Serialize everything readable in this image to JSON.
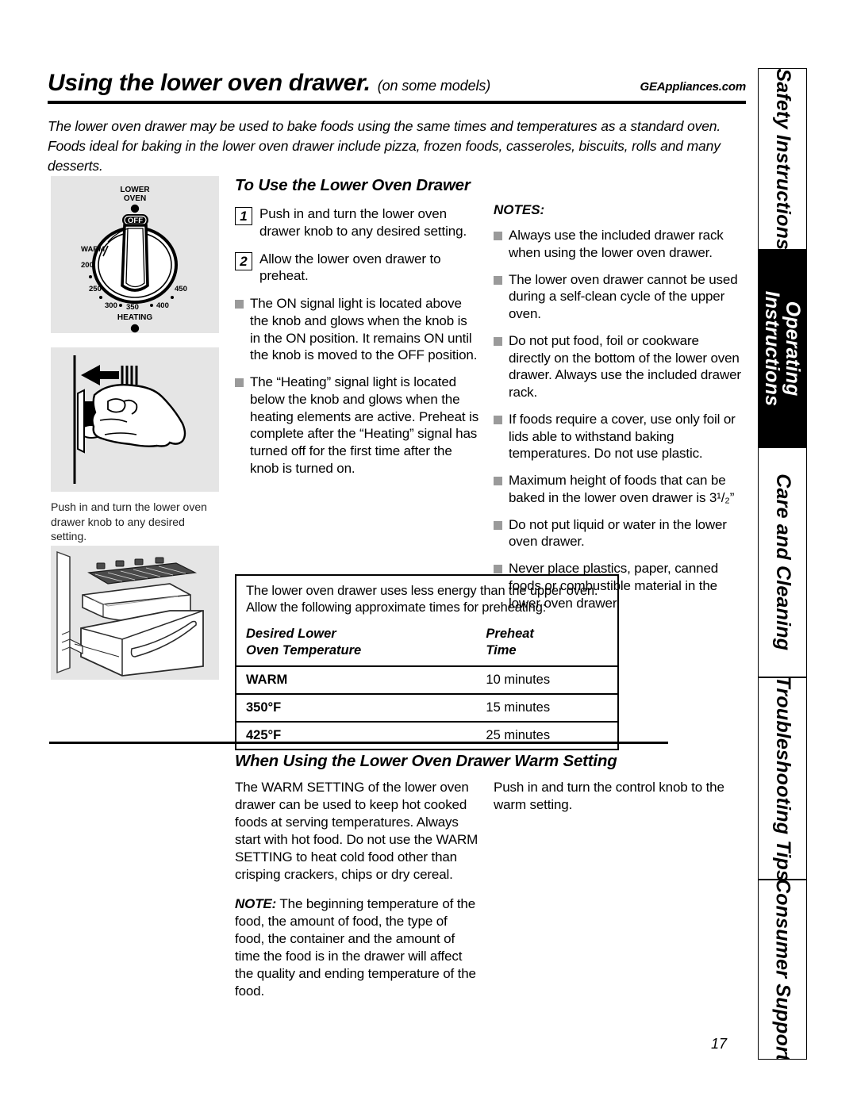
{
  "header": {
    "title": "Using the lower oven drawer.",
    "subtitle": "(on some models)",
    "url": "GEAppliances.com"
  },
  "intro": "The lower oven drawer may be used to bake foods using the same times and temperatures as a standard oven. Foods ideal for baking in the lower oven drawer include pizza, frozen foods, casseroles, biscuits, rolls and many desserts.",
  "sidebar": {
    "tabs": [
      {
        "label": "Safety Instructions",
        "active": false
      },
      {
        "label": "Operating Instructions",
        "active": true
      },
      {
        "label": "Care and Cleaning",
        "active": false
      },
      {
        "label": "Troubleshooting Tips",
        "active": false
      },
      {
        "label": "Consumer Support",
        "active": false
      }
    ]
  },
  "illustrations": {
    "knob": {
      "title_line1": "LOWER",
      "title_line2": "OVEN",
      "off": "OFF",
      "warm": "WARM",
      "heating": "HEATING",
      "marks": [
        "200",
        "250",
        "300",
        "350",
        "400",
        "450"
      ]
    },
    "hand_caption": "Push in and turn the lower oven drawer knob to any desired setting."
  },
  "use_section": {
    "heading": "To Use the Lower Oven Drawer",
    "steps": [
      {
        "num": "1",
        "text": "Push in and turn the lower oven drawer knob to any desired setting."
      },
      {
        "num": "2",
        "text": "Allow the lower oven drawer to preheat."
      }
    ],
    "bullets": [
      "The ON signal light is located above the knob and glows when the knob is in the ON position. It remains ON until the knob is moved to the OFF position.",
      "The “Heating” signal light is located below the knob and glows when the heating elements are active. Preheat is complete after the “Heating” signal has turned off for the first time after the knob is turned on."
    ]
  },
  "notes": {
    "heading": "NOTES:",
    "items": [
      "Always use the included drawer rack when using the lower oven drawer.",
      "The lower oven drawer cannot be used during a self-clean cycle of the upper oven.",
      "Do not put food, foil or cookware directly on the bottom of the lower oven drawer. Always use the included drawer rack.",
      "If foods require a cover, use only foil or lids able to withstand baking temperatures. Do not use plastic.",
      "Maximum height of foods that can be baked in the lower oven drawer is 3¹/₂”",
      "Do not put liquid or water in the lower oven drawer.",
      "Never place plastics, paper, canned foods or combustible material in the lower oven drawer."
    ]
  },
  "preheat_table": {
    "intro": "The lower oven drawer uses less energy than the upper oven. Allow the following approximate times for preheating:",
    "headers": {
      "col1_line1": "Desired Lower",
      "col1_line2": "Oven Temperature",
      "col2_line1": "Preheat",
      "col2_line2": "Time"
    },
    "rows": [
      {
        "temperature": "WARM",
        "time": "10 minutes"
      },
      {
        "temperature": "350°F",
        "time": "15 minutes"
      },
      {
        "temperature": "425°F",
        "time": "25 minutes"
      }
    ]
  },
  "warm_section": {
    "heading": "When Using the Lower Oven Drawer Warm Setting",
    "paragraph1": "The WARM SETTING of the lower oven drawer can be used to keep hot cooked foods at serving temperatures. Always start with hot food. Do not use the WARM SETTING to heat cold food other than crisping crackers, chips or dry cereal.",
    "note_label": "NOTE:",
    "note_text": " The beginning temperature of the food, the amount of food, the type of food, the container and the amount of time the food is in the drawer will affect the quality and ending temperature of the food.",
    "right_paragraph": "Push in and turn the control knob to the warm setting."
  },
  "page_number": "17"
}
